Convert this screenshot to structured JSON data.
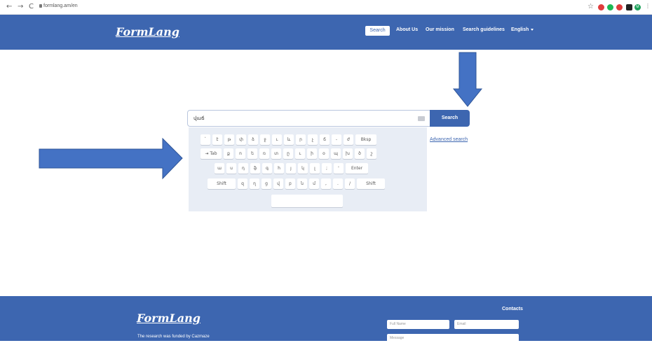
{
  "browser": {
    "back": "←",
    "forward": "→",
    "reload": "C",
    "url": "formlang.am/en",
    "star": "☆",
    "ext_colors": [
      "#e03c3c",
      "#1db954",
      "#e03c3c",
      "#222222",
      "#1da15a",
      "#2e8b57"
    ],
    "profile_initial": "M"
  },
  "header": {
    "logo": "FormLang",
    "nav": {
      "search": "Search",
      "about": "About Us",
      "mission": "Our mission",
      "guidelines": "Search guidelines",
      "language": "English"
    }
  },
  "search": {
    "value": "վաճ",
    "button": "Search",
    "advanced": "Advanced search"
  },
  "keyboard": {
    "row1": [
      "`",
      "է",
      "թ",
      "փ",
      "ձ",
      "ջ",
      "ւ",
      "և",
      "ր",
      "չ",
      "ճ",
      "-",
      "ժ",
      "Bksp"
    ],
    "row2": [
      "⇥ Tab",
      "ք",
      "ո",
      "ե",
      "ռ",
      "տ",
      "ը",
      "ւ",
      "ի",
      "օ",
      "պ",
      "խ",
      "ծ",
      "շ"
    ],
    "row3": [
      "ա",
      "ս",
      "դ",
      "ֆ",
      "գ",
      "հ",
      "յ",
      "կ",
      "լ",
      ";",
      "'",
      "Enter"
    ],
    "row4": [
      "Shift",
      "զ",
      "ղ",
      "ց",
      "վ",
      "բ",
      "ն",
      "մ",
      ",",
      ".",
      "/",
      "Shift"
    ]
  },
  "footer": {
    "logo": "FormLang",
    "funded": "The research was funded by Cazmaze",
    "contacts": "Contacts",
    "fields": {
      "full_name": "Full Name",
      "email": "Email",
      "message": "Message"
    }
  },
  "colors": {
    "brand": "#3d66b0",
    "arrow": "#4472c4",
    "keyboard_bg": "#e8edf5"
  },
  "icons": {
    "keyboard": "keyboard-icon",
    "lock": "lock-icon",
    "arrow_down": "arrow-down-icon",
    "arrow_right": "arrow-right-icon"
  }
}
